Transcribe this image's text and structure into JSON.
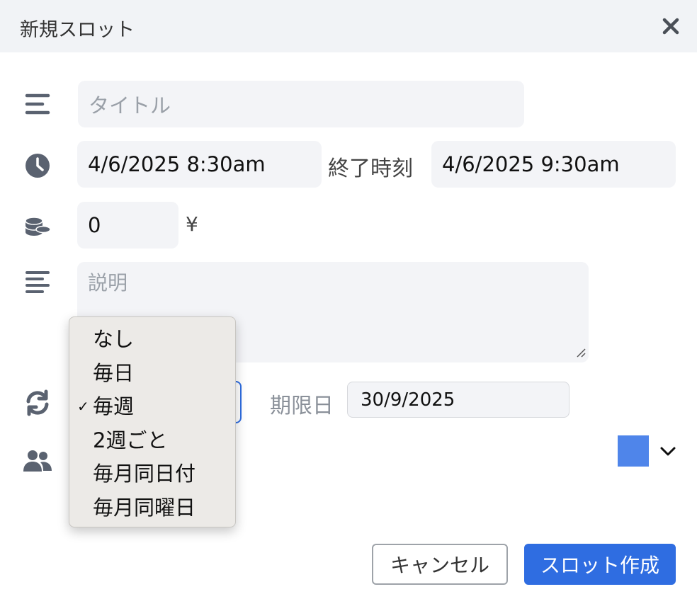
{
  "dialog": {
    "title": "新規スロット",
    "title_placeholder": "タイトル",
    "start": "4/6/2025 8:30am",
    "end_label": "終了時刻",
    "end": "4/6/2025 9:30am",
    "price": "0",
    "currency": "¥",
    "description_placeholder": "説明",
    "deadline_label": "期限日",
    "deadline": "30/9/2025",
    "color": "#4f85ea"
  },
  "recurrence": {
    "options": [
      "なし",
      "毎日",
      "毎週",
      "2週ごと",
      "毎月同日付",
      "毎月同曜日"
    ],
    "selected": "毎週",
    "check": "✓"
  },
  "buttons": {
    "cancel": "キャンセル",
    "create": "スロット作成"
  },
  "icons": [
    "title-lines-icon",
    "clock-icon",
    "coins-icon",
    "description-lines-icon",
    "repeat-icon",
    "users-icon",
    "close-icon",
    "chevron-down-icon"
  ]
}
